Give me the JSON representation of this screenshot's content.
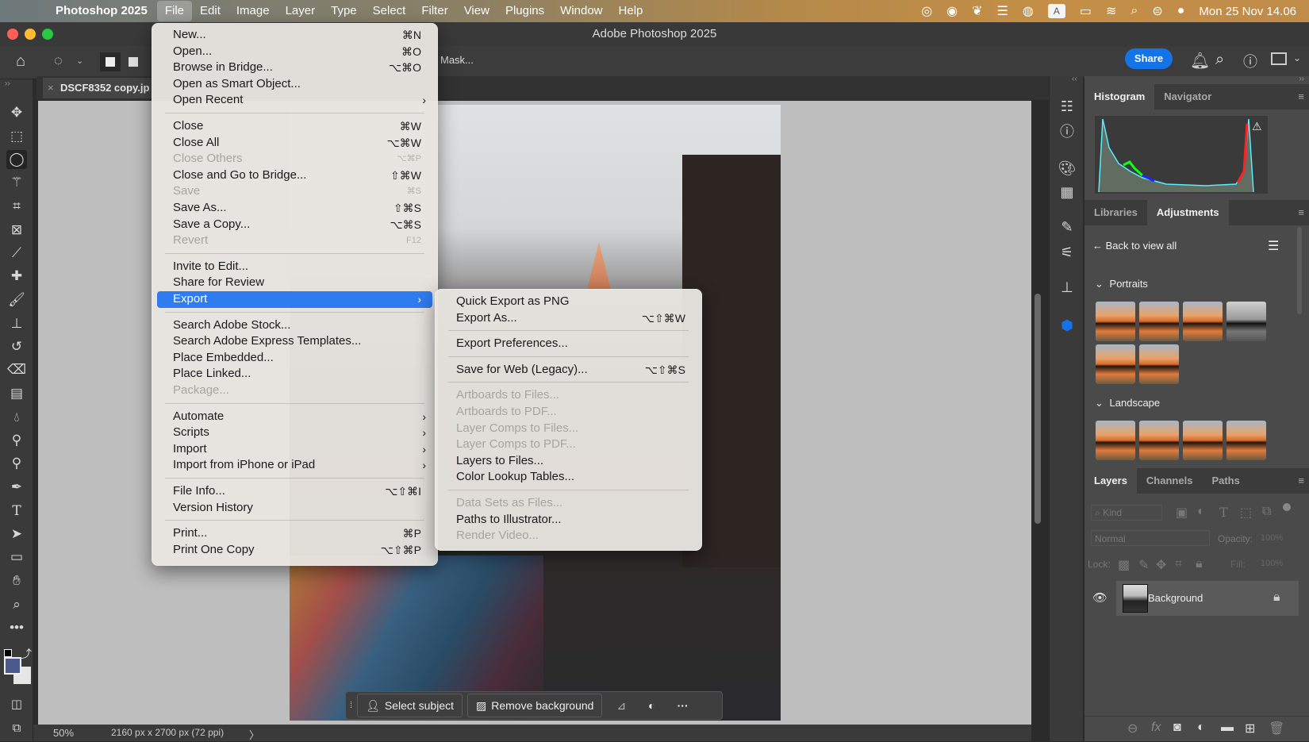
{
  "menubar": {
    "app_name": "Photoshop 2025",
    "items": [
      "File",
      "Edit",
      "Image",
      "Layer",
      "Type",
      "Select",
      "Filter",
      "View",
      "Plugins",
      "Window",
      "Help"
    ],
    "active": "File",
    "clock": "Mon 25 Nov  14.06",
    "status_icons": [
      "creative-cloud-icon",
      "sync-icon",
      "peacock-icon",
      "dock-icon",
      "user-icon",
      "input-source-A",
      "battery-icon",
      "wifi-icon",
      "spotlight-icon",
      "control-center-icon",
      "siri-icon"
    ],
    "input_source_label": "A"
  },
  "window": {
    "title": "Adobe Photoshop 2025"
  },
  "options_bar": {
    "mask_button_label": "Mask...",
    "share_label": "Share"
  },
  "document_tab": {
    "name": "DSCF8352 copy.jp",
    "close_glyph": "×"
  },
  "file_menu": {
    "groups": [
      [
        {
          "label": "New...",
          "shortcut": "⌘N",
          "enabled": true
        },
        {
          "label": "Open...",
          "shortcut": "⌘O",
          "enabled": true
        },
        {
          "label": "Browse in Bridge...",
          "shortcut": "⌥⌘O",
          "enabled": true
        },
        {
          "label": "Open as Smart Object...",
          "shortcut": "",
          "enabled": true
        },
        {
          "label": "Open Recent",
          "shortcut": "",
          "submenu": true,
          "enabled": true
        }
      ],
      [
        {
          "label": "Close",
          "shortcut": "⌘W",
          "enabled": true
        },
        {
          "label": "Close All",
          "shortcut": "⌥⌘W",
          "enabled": true
        },
        {
          "label": "Close Others",
          "shortcut": "⌥⌘P",
          "enabled": false
        },
        {
          "label": "Close and Go to Bridge...",
          "shortcut": "⇧⌘W",
          "enabled": true
        },
        {
          "label": "Save",
          "shortcut": "⌘S",
          "enabled": false
        },
        {
          "label": "Save As...",
          "shortcut": "⇧⌘S",
          "enabled": true
        },
        {
          "label": "Save a Copy...",
          "shortcut": "⌥⌘S",
          "enabled": true
        },
        {
          "label": "Revert",
          "shortcut": "F12",
          "enabled": false
        }
      ],
      [
        {
          "label": "Invite to Edit...",
          "shortcut": "",
          "enabled": true
        },
        {
          "label": "Share for Review",
          "shortcut": "",
          "enabled": true
        },
        {
          "label": "Export",
          "shortcut": "",
          "submenu": true,
          "enabled": true,
          "selected": true
        }
      ],
      [
        {
          "label": "Search Adobe Stock...",
          "shortcut": "",
          "enabled": true
        },
        {
          "label": "Search Adobe Express Templates...",
          "shortcut": "",
          "enabled": true
        },
        {
          "label": "Place Embedded...",
          "shortcut": "",
          "enabled": true
        },
        {
          "label": "Place Linked...",
          "shortcut": "",
          "enabled": true
        },
        {
          "label": "Package...",
          "shortcut": "",
          "enabled": false
        }
      ],
      [
        {
          "label": "Automate",
          "shortcut": "",
          "submenu": true,
          "enabled": true
        },
        {
          "label": "Scripts",
          "shortcut": "",
          "submenu": true,
          "enabled": true
        },
        {
          "label": "Import",
          "shortcut": "",
          "submenu": true,
          "enabled": true
        },
        {
          "label": "Import from iPhone or iPad",
          "shortcut": "",
          "submenu": true,
          "enabled": true
        }
      ],
      [
        {
          "label": "File Info...",
          "shortcut": "⌥⇧⌘I",
          "enabled": true
        },
        {
          "label": "Version History",
          "shortcut": "",
          "enabled": true
        }
      ],
      [
        {
          "label": "Print...",
          "shortcut": "⌘P",
          "enabled": true
        },
        {
          "label": "Print One Copy",
          "shortcut": "⌥⇧⌘P",
          "enabled": true
        }
      ]
    ]
  },
  "export_submenu": {
    "groups": [
      [
        {
          "label": "Quick Export as PNG",
          "shortcut": "",
          "enabled": true
        },
        {
          "label": "Export As...",
          "shortcut": "⌥⇧⌘W",
          "enabled": true
        }
      ],
      [
        {
          "label": "Export Preferences...",
          "shortcut": "",
          "enabled": true
        }
      ],
      [
        {
          "label": "Save for Web (Legacy)...",
          "shortcut": "⌥⇧⌘S",
          "enabled": true
        }
      ],
      [
        {
          "label": "Artboards to Files...",
          "shortcut": "",
          "enabled": false
        },
        {
          "label": "Artboards to PDF...",
          "shortcut": "",
          "enabled": false
        },
        {
          "label": "Layer Comps to Files...",
          "shortcut": "",
          "enabled": false
        },
        {
          "label": "Layer Comps to PDF...",
          "shortcut": "",
          "enabled": false
        },
        {
          "label": "Layers to Files...",
          "shortcut": "",
          "enabled": true
        },
        {
          "label": "Color Lookup Tables...",
          "shortcut": "",
          "enabled": true
        }
      ],
      [
        {
          "label": "Data Sets as Files...",
          "shortcut": "",
          "enabled": false
        },
        {
          "label": "Paths to Illustrator...",
          "shortcut": "",
          "enabled": true
        },
        {
          "label": "Render Video...",
          "shortcut": "",
          "enabled": false
        }
      ]
    ]
  },
  "tools": [
    "move",
    "rectangular-marquee",
    "lasso",
    "magic-wand",
    "crop",
    "frame",
    "eyedropper",
    "healing-brush",
    "brush",
    "clone-stamp",
    "history-brush",
    "eraser",
    "gradient",
    "blur",
    "dodge-burn",
    "dodge",
    "pen",
    "type",
    "path-selection",
    "rectangle",
    "hand",
    "zoom",
    "more"
  ],
  "colors": {
    "foreground": "#4a5a8c",
    "background": "#e6e6e6",
    "accent": "#1473e6",
    "menu_highlight": "#2f7bf0"
  },
  "contextual_bar": {
    "select_subject": "Select subject",
    "remove_background": "Remove background"
  },
  "status_bar": {
    "zoom": "50%",
    "doc_info": "2160 px x 2700 px (72 ppi)"
  },
  "panels": {
    "histogram_tabs": [
      "Histogram",
      "Navigator"
    ],
    "adjust_tabs": [
      "Libraries",
      "Adjustments"
    ],
    "back_label": "Back to view all",
    "sections": [
      {
        "name": "Portraits",
        "presets": 6
      },
      {
        "name": "Landscape",
        "presets": 4
      }
    ],
    "layers_tabs": [
      "Layers",
      "Channels",
      "Paths"
    ],
    "layers_filter_placeholder": "Kind",
    "blend_mode": "Normal",
    "opacity_label": "Opacity:",
    "opacity_value": "100%",
    "lock_label": "Lock:",
    "fill_label": "Fill:",
    "fill_value": "100%",
    "layers": [
      {
        "name": "Background",
        "visible": true,
        "locked": true
      }
    ]
  }
}
